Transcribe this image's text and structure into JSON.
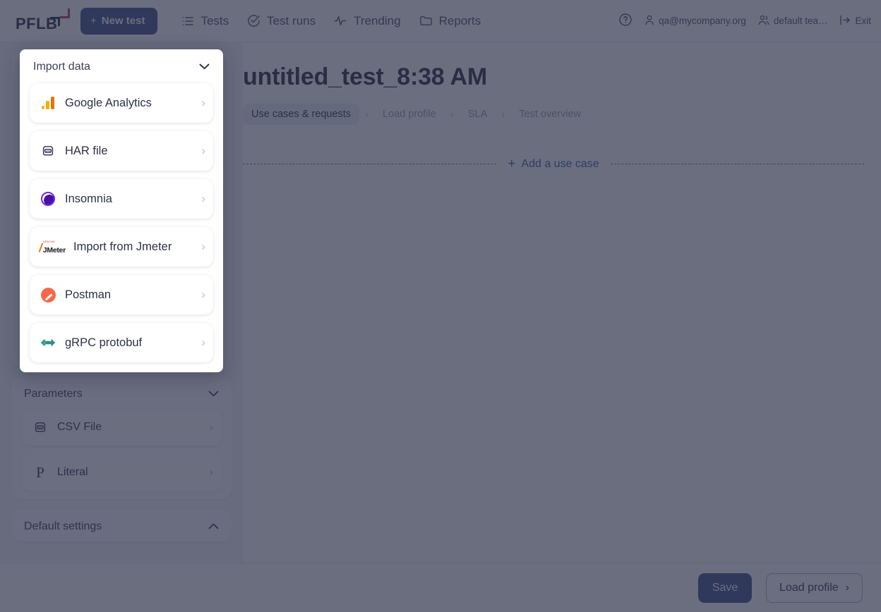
{
  "header": {
    "logo_text": "PFLB",
    "new_test_label": "New test",
    "new_test_plus": "+",
    "nav": [
      {
        "label": "Tests",
        "icon": "list-icon"
      },
      {
        "label": "Test runs",
        "icon": "check-circle-icon"
      },
      {
        "label": "Trending",
        "icon": "activity-icon"
      },
      {
        "label": "Reports",
        "icon": "folder-icon"
      }
    ],
    "right": [
      {
        "label": "",
        "icon": "help-circle-icon"
      },
      {
        "label": "qa@mycompany.org",
        "icon": "user-icon"
      },
      {
        "label": "default tea…",
        "icon": "users-icon"
      },
      {
        "label": "Exit",
        "icon": "logout-icon"
      }
    ]
  },
  "import_popover": {
    "title": "Import data",
    "collapse_icon": "chevron-down-icon",
    "items": [
      {
        "label": "Google Analytics",
        "icon": "google-analytics-icon"
      },
      {
        "label": "HAR file",
        "icon": "har-file-icon"
      },
      {
        "label": "Insomnia",
        "icon": "insomnia-icon"
      },
      {
        "label": "Import from Jmeter",
        "icon": "jmeter-icon"
      },
      {
        "label": "Postman",
        "icon": "postman-icon"
      },
      {
        "label": "gRPC protobuf",
        "icon": "grpc-icon"
      }
    ],
    "row_chevron": "›"
  },
  "sidebar": {
    "parameters": {
      "title": "Parameters",
      "collapse_icon": "chevron-down-icon",
      "items": [
        {
          "label": "CSV File",
          "icon": "csv-file-icon"
        },
        {
          "label": "Literal",
          "icon": "literal-p-icon"
        }
      ]
    },
    "default_settings": {
      "title": "Default settings",
      "collapse_icon": "chevron-up-icon"
    },
    "row_chevron": "›"
  },
  "main": {
    "page_title": "untitled_test_8:38 AM",
    "breadcrumb": [
      {
        "label": "Use cases & requests",
        "active": true
      },
      {
        "label": "Load profile",
        "active": false
      },
      {
        "label": "SLA",
        "active": false
      },
      {
        "label": "Test overview",
        "active": false
      }
    ],
    "breadcrumb_separator": "›",
    "add_use_case": {
      "label": "Add a use case",
      "plus": "+"
    }
  },
  "footer": {
    "save_label": "Save",
    "load_profile_label": "Load profile",
    "load_profile_chevron": "›"
  },
  "colors": {
    "brand_primary": "#3c4a8a",
    "accent_link": "#3f55ab",
    "backdrop": "#2b3048",
    "text_dark": "#2d3247",
    "logo_red": "#b23a48"
  }
}
